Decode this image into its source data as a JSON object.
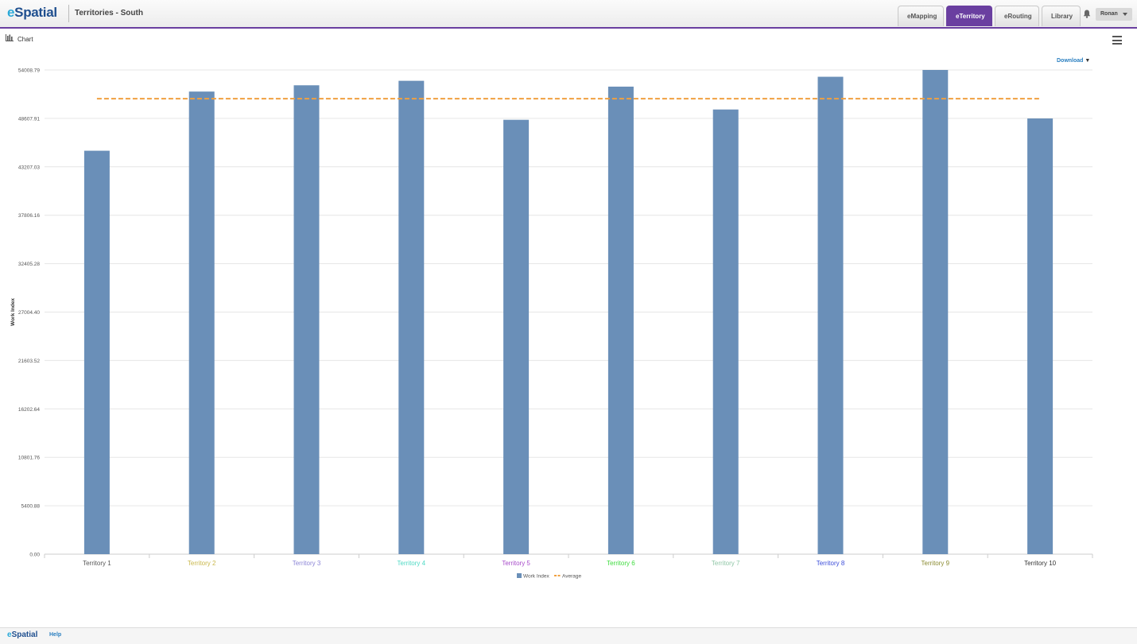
{
  "header": {
    "logo_e": "e",
    "logo_rest": "Spatial",
    "title": "Territories - South",
    "tabs": [
      {
        "label": "eMapping"
      },
      {
        "label": "eTerritory"
      },
      {
        "label": "eRouting"
      },
      {
        "label": "Library"
      }
    ],
    "active_tab": "eTerritory",
    "user": "Ronan",
    "accent_color": "#6a3fa0"
  },
  "panel": {
    "title": "Chart",
    "download_label": "Download",
    "download_arrow": "▼"
  },
  "chart_data": {
    "type": "bar",
    "title": "",
    "xlabel": "",
    "ylabel": "Work Index",
    "ylim": [
      0,
      54008.79
    ],
    "yticks": [
      "0.00",
      "5400.88",
      "10801.76",
      "16202.64",
      "21603.52",
      "27004.40",
      "32405.28",
      "37806.16",
      "43207.03",
      "48607.91",
      "54008.79"
    ],
    "categories": [
      "Territory 1",
      "Territory 2",
      "Territory 3",
      "Territory 4",
      "Territory 5",
      "Territory 6",
      "Territory 7",
      "Territory 8",
      "Territory 9",
      "Territory 10"
    ],
    "category_colors": [
      "#555555",
      "#c9b74a",
      "#8b84d6",
      "#4dd9c4",
      "#a64ac9",
      "#3ddb3d",
      "#8fc6a6",
      "#3b4cd9",
      "#8a8a30",
      "#333333"
    ],
    "series": [
      {
        "name": "Work Index",
        "color": "#6a8fb8",
        "values": [
          45000,
          51600,
          52300,
          52800,
          48450,
          52150,
          49600,
          53250,
          54008.79,
          48600
        ]
      },
      {
        "name": "Average",
        "color": "#f0a040",
        "style": "dashed-line",
        "value": 50800
      }
    ],
    "legend_position": "bottom-center",
    "grid": true
  },
  "footer": {
    "logo_e": "e",
    "logo_rest": "Spatial",
    "help_label": "Help"
  }
}
